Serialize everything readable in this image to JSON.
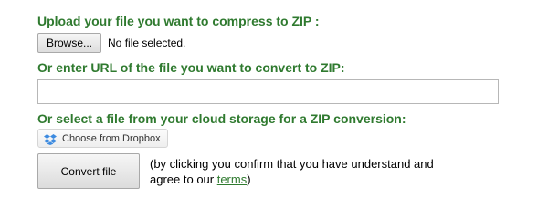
{
  "upload": {
    "heading": "Upload your file you want to compress to ZIP :",
    "browse_label": "Browse...",
    "file_status": "No file selected."
  },
  "url": {
    "heading": "Or enter URL of the file you want to convert to ZIP:",
    "value": "",
    "placeholder": ""
  },
  "cloud": {
    "heading": "Or select a file from your cloud storage for a ZIP conversion:",
    "dropbox_label": "Choose from Dropbox",
    "dropbox_icon": "dropbox-icon"
  },
  "convert": {
    "button_label": "Convert file",
    "agree_prefix": "(by clicking you confirm that you have understand and agree to our ",
    "terms_label": "terms",
    "agree_suffix": ")"
  },
  "colors": {
    "heading": "#2f7a2f",
    "link": "#2f7a2f",
    "dropbox": "#3d8be0"
  }
}
